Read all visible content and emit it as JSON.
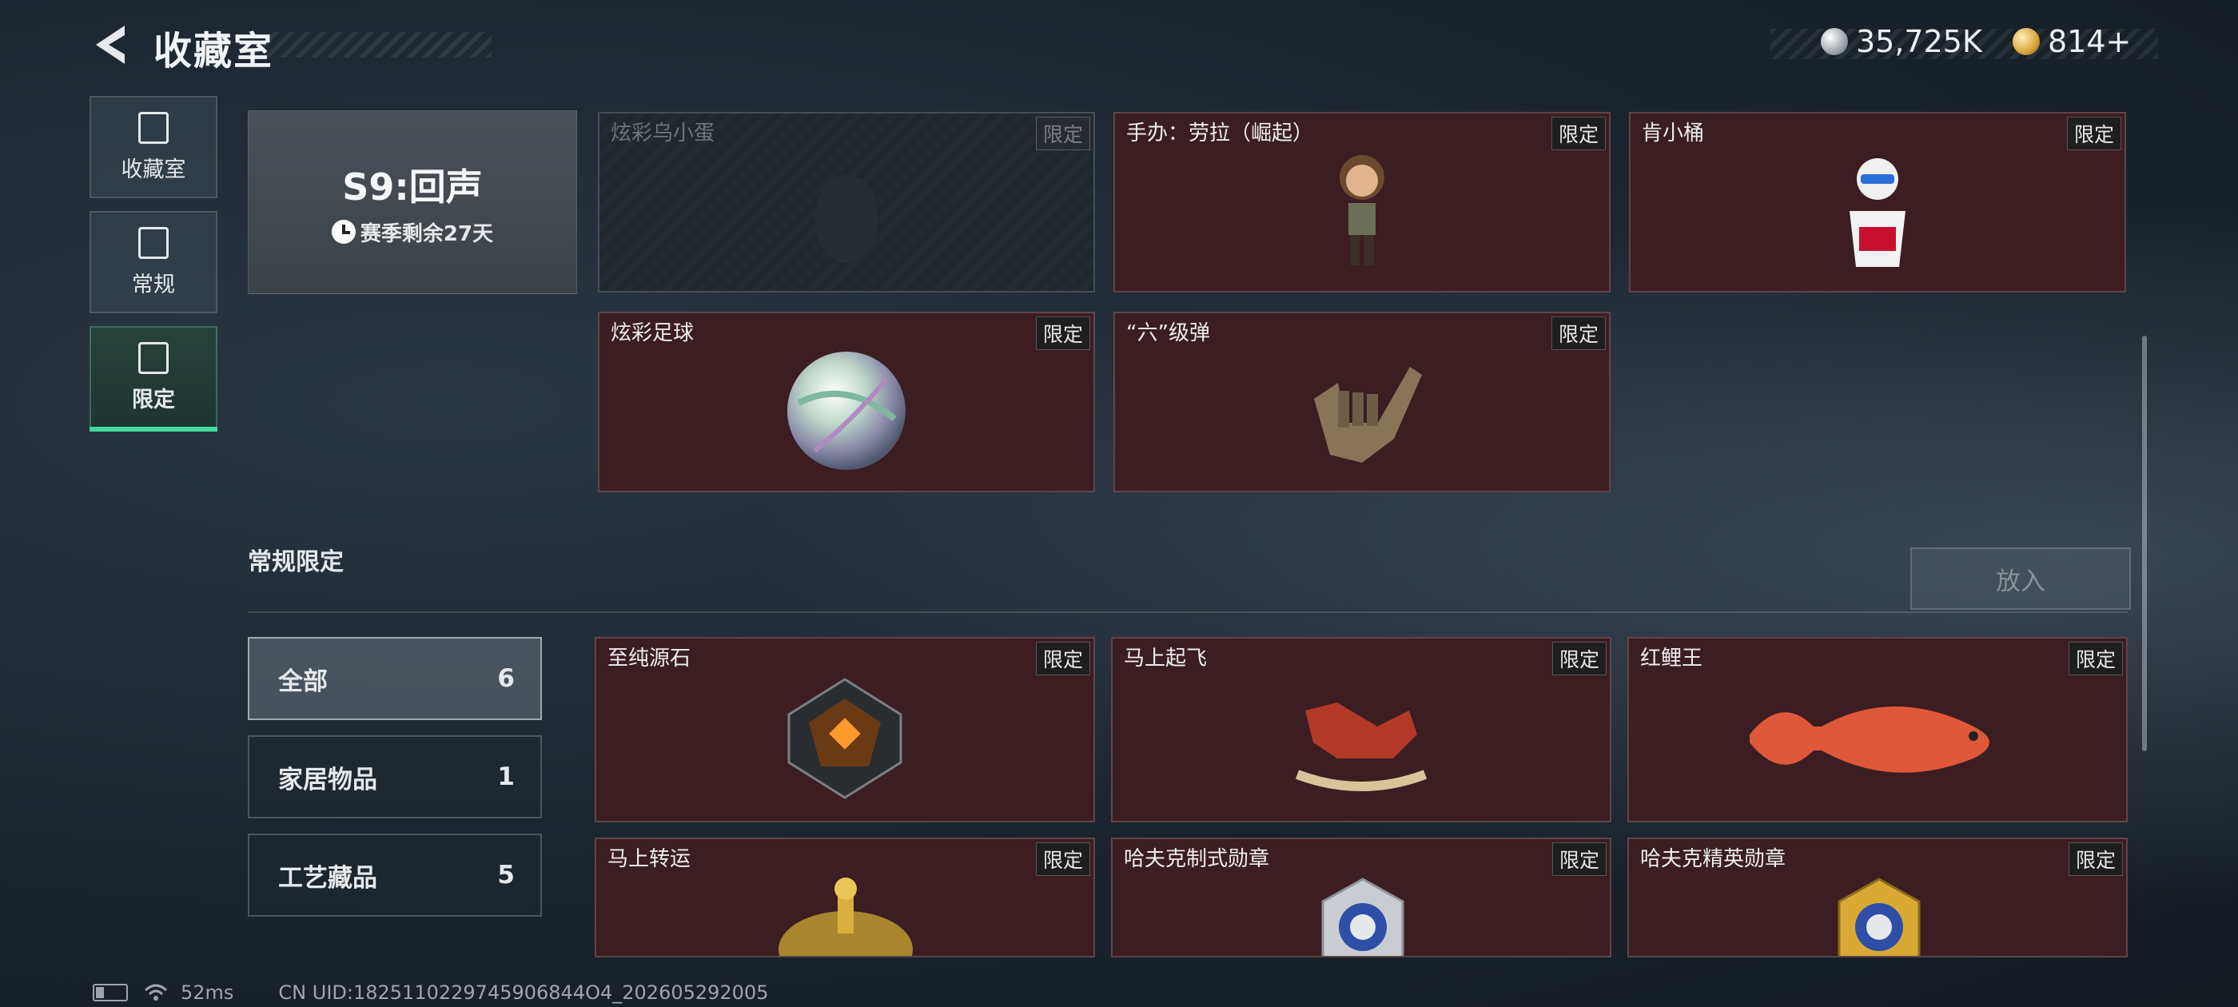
{
  "header": {
    "title": "收藏室"
  },
  "currency": {
    "silver": "35,725K",
    "gold": "814+"
  },
  "sidebar": {
    "items": [
      {
        "label": "收藏室"
      },
      {
        "label": "常规"
      },
      {
        "label": "限定"
      }
    ]
  },
  "season": {
    "title": "S9:回声",
    "remaining": "赛季剩余27天"
  },
  "season_items": [
    {
      "name": "炫彩乌小蛋",
      "badge": "限定",
      "locked": true
    },
    {
      "name": "手办：劳拉（崛起）",
      "badge": "限定"
    },
    {
      "name": "肯小桶",
      "badge": "限定"
    },
    {
      "name": "炫彩足球",
      "badge": "限定"
    },
    {
      "name": "“六”级弹",
      "badge": "限定"
    }
  ],
  "regular_section": {
    "title": "常规限定",
    "put_button": "放入"
  },
  "filters": [
    {
      "label": "全部",
      "count": "6"
    },
    {
      "label": "家居物品",
      "count": "1"
    },
    {
      "label": "工艺藏品",
      "count": "5"
    }
  ],
  "regular_items": [
    {
      "name": "至纯源石",
      "badge": "限定"
    },
    {
      "name": "马上起飞",
      "badge": "限定"
    },
    {
      "name": "红鲤王",
      "badge": "限定"
    },
    {
      "name": "马上转运",
      "badge": "限定"
    },
    {
      "name": "哈夫克制式勋章",
      "badge": "限定"
    },
    {
      "name": "哈夫克精英勋章",
      "badge": "限定"
    }
  ],
  "status": {
    "ping": "52ms",
    "uid": "CN UID:1825110229745906844O4_202605292005"
  },
  "colors": {
    "accent": "#43d99a",
    "card": "#3c1d22"
  }
}
